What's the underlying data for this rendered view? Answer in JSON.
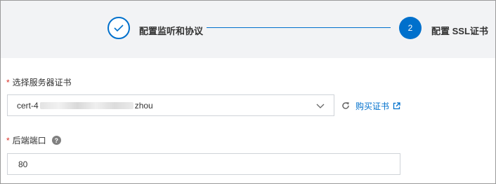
{
  "steps": [
    {
      "label": "配置监听和协议",
      "state": "done"
    },
    {
      "number": "2",
      "label": "配置 SSL证书",
      "state": "active"
    }
  ],
  "form": {
    "required_mark": "*",
    "certificate": {
      "label": "选择服务器证书",
      "value_prefix": "cert-4",
      "value_suffix": "zhou",
      "buy_link": "购买证书"
    },
    "backend_port": {
      "label": "后端端口",
      "help": "?",
      "value": "80"
    }
  },
  "colors": {
    "accent": "#0070cc",
    "required": "#d93026",
    "stepbar_bg": "#f2f3f5"
  },
  "icons": [
    "check-icon",
    "chevron-down-icon",
    "refresh-icon",
    "external-link-icon",
    "help-icon"
  ]
}
